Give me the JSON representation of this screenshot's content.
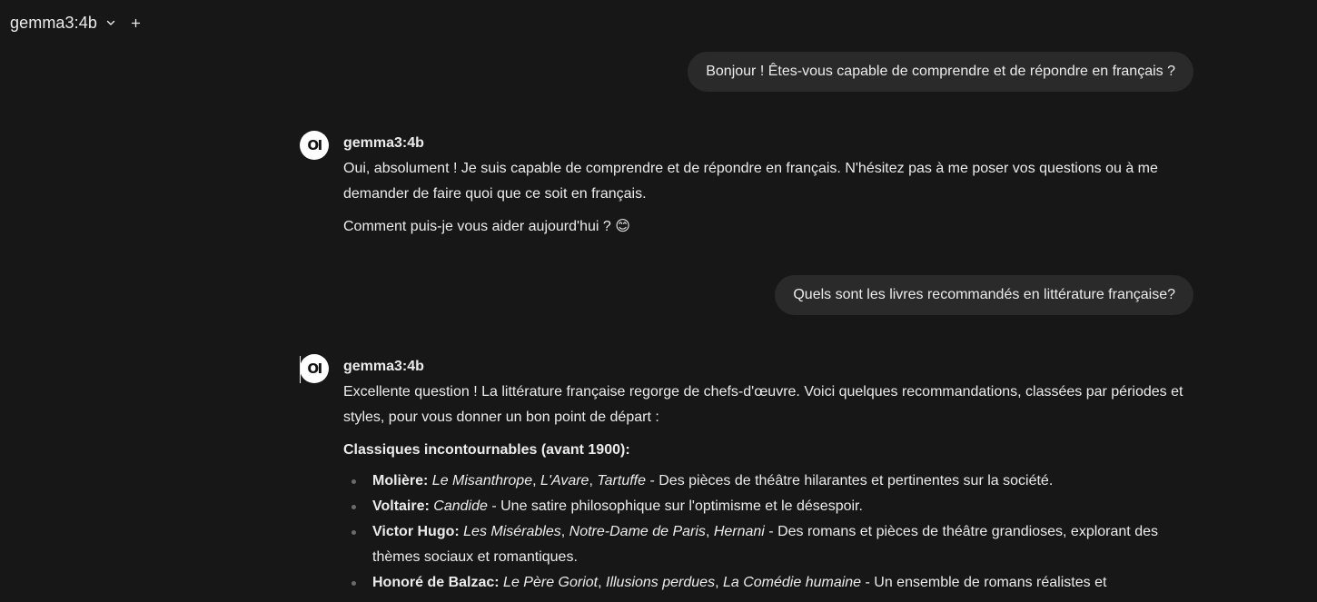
{
  "header": {
    "model_name": "gemma3:4b",
    "dropdown_icon": "chevron-down-icon",
    "new_chat_icon": "plus-icon"
  },
  "messages": [
    {
      "role": "user",
      "text": "Bonjour ! Êtes-vous capable de comprendre et de répondre en français ?"
    },
    {
      "role": "assistant",
      "sender": "gemma3:4b",
      "avatar_text": "OI",
      "paragraphs": [
        "Oui, absolument ! Je suis capable de comprendre et de répondre en français. N'hésitez pas à me poser vos questions ou à me demander de faire quoi que ce soit en français.",
        "Comment puis-je vous aider aujourd'hui ? 😊"
      ]
    },
    {
      "role": "user",
      "text": "Quels sont les livres recommandés en littérature française?"
    },
    {
      "role": "assistant",
      "sender": "gemma3:4b",
      "avatar_text": "OI",
      "intro": "Excellente question ! La littérature française regorge de chefs-d'œuvre. Voici quelques recommandations, classées par périodes et styles, pour vous donner un bon point de départ :",
      "section_heading": "Classiques incontournables (avant 1900):",
      "items": [
        {
          "author": "Molière:",
          "titles": [
            "Le Misanthrope",
            "L'Avare",
            "Tartuffe"
          ],
          "description": "Des pièces de théâtre hilarantes et pertinentes sur la société."
        },
        {
          "author": "Voltaire:",
          "titles": [
            "Candide"
          ],
          "description": "Une satire philosophique sur l'optimisme et le désespoir."
        },
        {
          "author": "Victor Hugo:",
          "titles": [
            "Les Misérables",
            "Notre-Dame de Paris",
            "Hernani"
          ],
          "description": "Des romans et pièces de théâtre grandioses, explorant des thèmes sociaux et romantiques."
        },
        {
          "author": "Honoré de Balzac:",
          "titles": [
            "Le Père Goriot",
            "Illusions perdues",
            "La Comédie humaine"
          ],
          "description": "Un ensemble de romans réalistes et"
        }
      ]
    }
  ],
  "colors": {
    "background": "#171717",
    "user_bubble": "#2a2a2a",
    "text": "#ececec",
    "avatar_bg": "#ffffff",
    "bullet": "#6b6b6b"
  }
}
